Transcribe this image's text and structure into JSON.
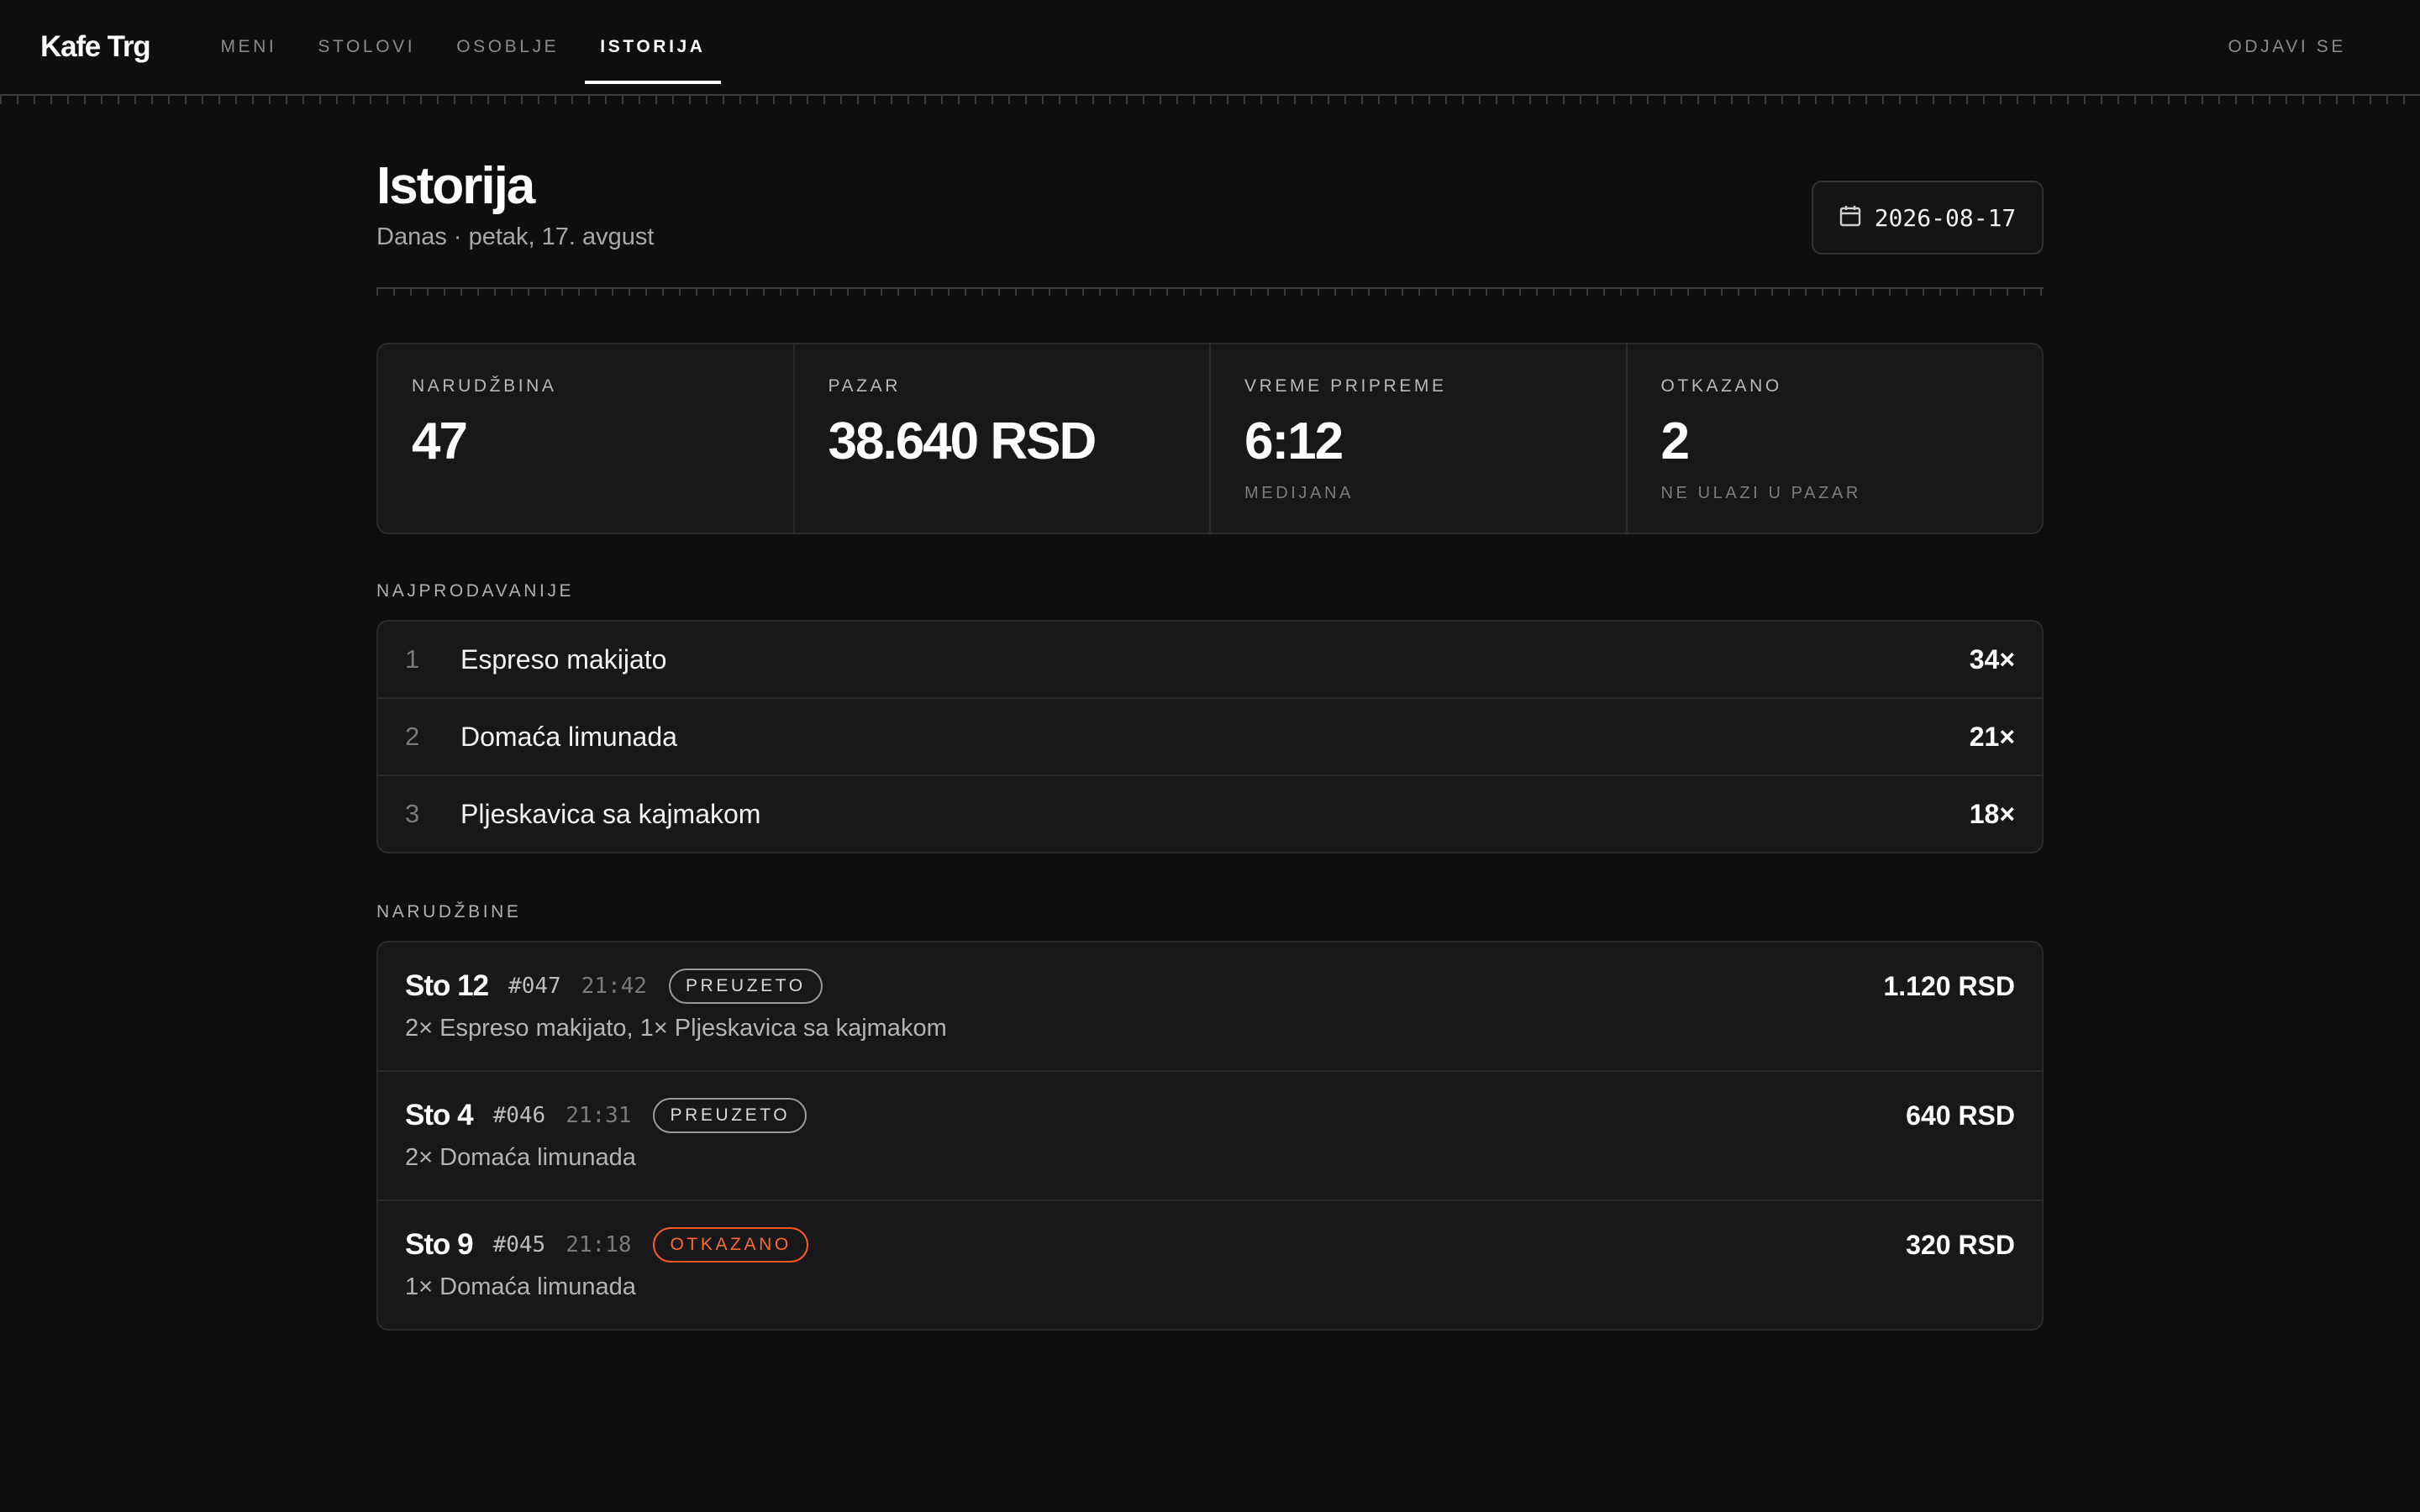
{
  "brand": "Kafe Trg",
  "nav": {
    "tabs": [
      {
        "label": "MENI"
      },
      {
        "label": "STOLOVI"
      },
      {
        "label": "OSOBLJE"
      },
      {
        "label": "ISTORIJA",
        "active": true
      }
    ],
    "logout_label": "ODJAVI SE"
  },
  "page": {
    "title": "Istorija",
    "subtitle": "Danas · petak, 17. avgust",
    "date_value": "2026-08-17",
    "date_icon": "calendar-icon"
  },
  "stats": [
    {
      "label": "NARUDŽBINA",
      "value": "47",
      "note": ""
    },
    {
      "label": "PAZAR",
      "value": "38.640 RSD",
      "note": ""
    },
    {
      "label": "VREME PRIPREME",
      "value": "6:12",
      "note": "MEDIJANA"
    },
    {
      "label": "OTKAZANO",
      "value": "2",
      "note": "NE ULAZI U PAZAR"
    }
  ],
  "bestsellers": {
    "heading": "NAJPRODAVANIJE",
    "items": [
      {
        "rank": "1",
        "name": "Espreso makijato",
        "count": "34×"
      },
      {
        "rank": "2",
        "name": "Domaća limunada",
        "count": "21×"
      },
      {
        "rank": "3",
        "name": "Pljeskavica sa kajmakom",
        "count": "18×"
      }
    ]
  },
  "orders": {
    "heading": "NARUDŽBINE",
    "items": [
      {
        "table": "Sto 12",
        "number": "#047",
        "time": "21:42",
        "status": "PREUZETO",
        "status_kind": "done",
        "items": "2× Espreso makijato, 1× Pljeskavica sa kajmakom",
        "total": "1.120 RSD"
      },
      {
        "table": "Sto 4",
        "number": "#046",
        "time": "21:31",
        "status": "PREUZETO",
        "status_kind": "done",
        "items": "2× Domaća limunada",
        "total": "640 RSD"
      },
      {
        "table": "Sto 9",
        "number": "#045",
        "time": "21:18",
        "status": "OTKAZANO",
        "status_kind": "cancelled",
        "items": "1× Domaća limunada",
        "total": "320 RSD"
      }
    ]
  },
  "colors": {
    "background": "#0e0e0e",
    "card": "#18181a",
    "accent_cancel": "#ff5a1f"
  }
}
